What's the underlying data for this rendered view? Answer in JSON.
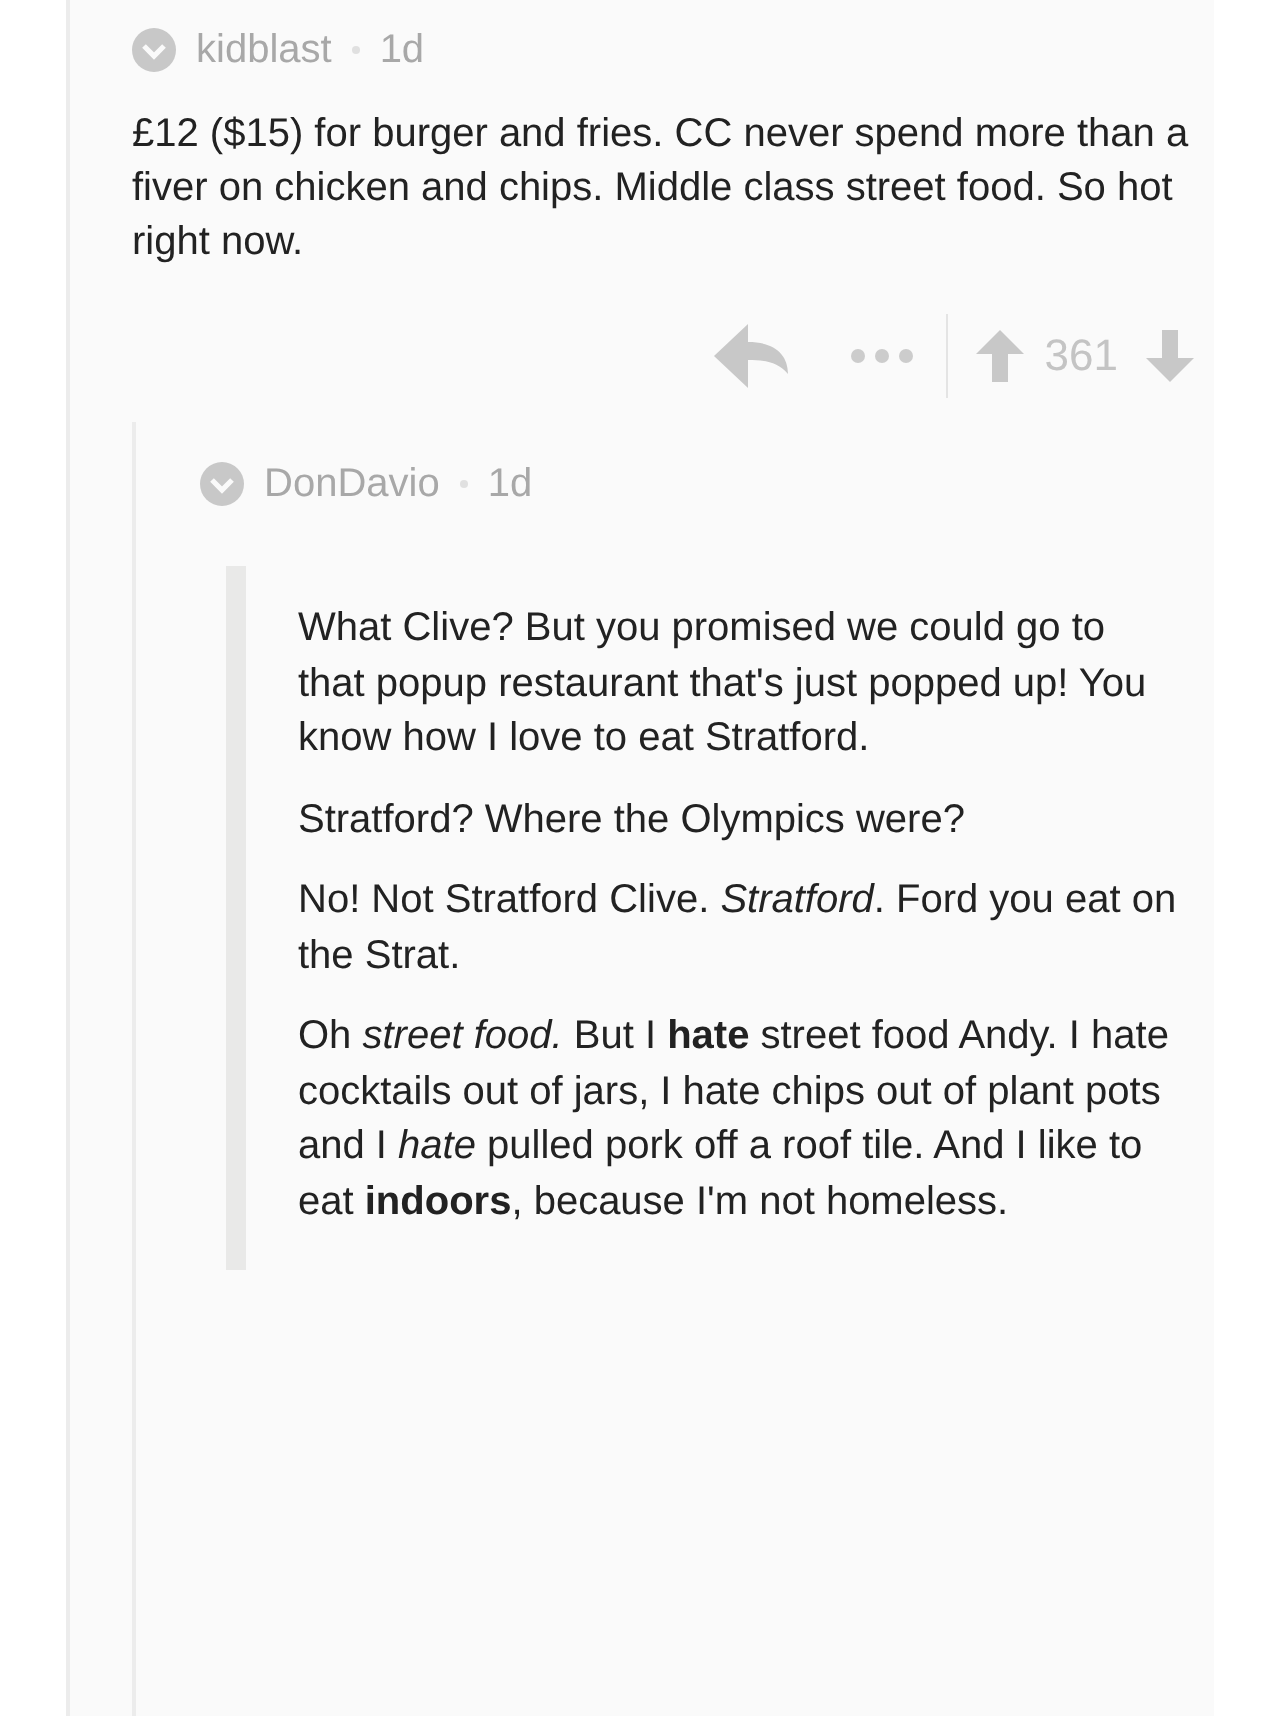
{
  "comment": {
    "username": "kidblast",
    "age": "1d",
    "body": "£12 ($15) for burger and fries. CC never spend more than a fiver on chicken and chips. Middle class street food. So hot right now.",
    "score": "361",
    "reply": {
      "username": "DonDavio",
      "age": "1d",
      "quote": [
        "What Clive? But you promised we could go to that popup restaurant that's just popped up! You know how I love to eat Stratford.",
        "Stratford? Where the Olympics were?",
        "No! Not Stratford Clive. *Stratford*. Ford you eat on the Strat.",
        "Oh *street food.* But I **hate** street food Andy. I hate cocktails out of jars, I hate chips out of plant pots and I *hate* pulled pork off a roof tile. And I like to eat **indoors**, because I'm not homeless."
      ]
    }
  }
}
